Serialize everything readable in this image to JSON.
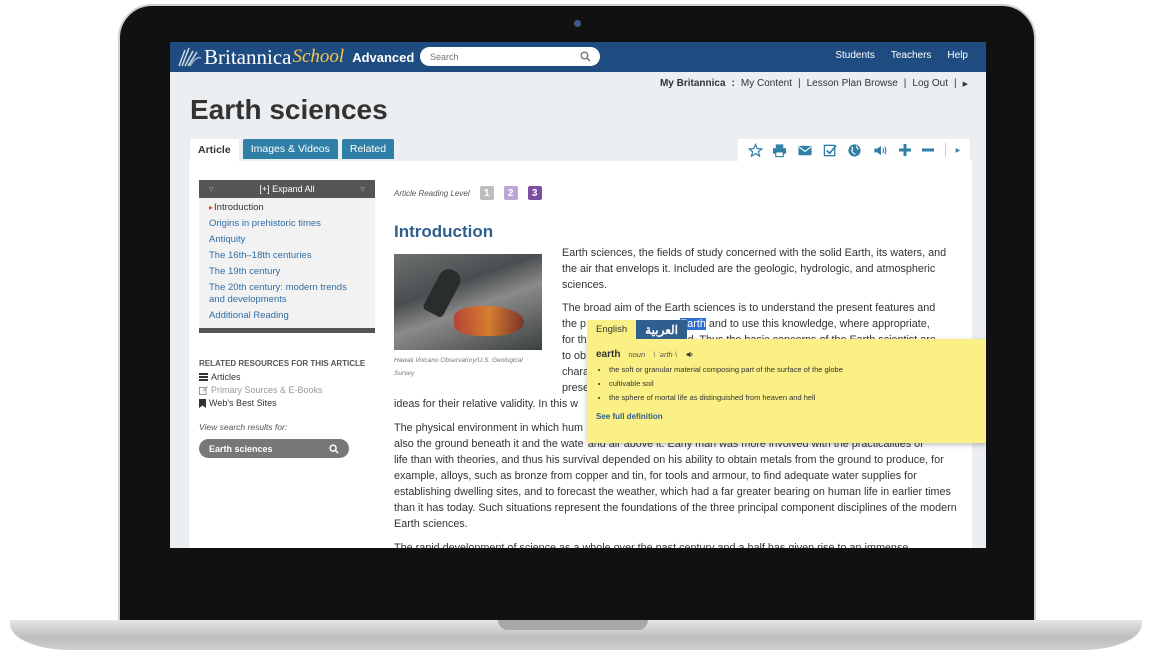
{
  "topbar": {
    "brand": "Britannica",
    "brand_school": "School",
    "edition": "Advanced",
    "search_placeholder": "Search",
    "links": [
      "Students",
      "Teachers",
      "Help"
    ]
  },
  "userbar": {
    "label": "My Britannica",
    "sep": ":",
    "items": [
      "My Content",
      "|",
      "Lesson Plan Browse",
      "|",
      "Log Out",
      "|"
    ]
  },
  "page_title": "Earth sciences",
  "tabs": [
    "Article",
    "Images & Videos",
    "Related"
  ],
  "tools": {
    "icons": [
      "star-icon",
      "print-icon",
      "email-icon",
      "cite-icon",
      "translate-globe-icon",
      "audio-icon",
      "zoom-in-icon",
      "zoom-out-icon"
    ],
    "accent": "#2f7fa6"
  },
  "toc": {
    "expand_label": "[+] Expand All",
    "items": [
      "Introduction",
      "Origins in prehistoric times",
      "Antiquity",
      "The 16th–18th centuries",
      "The 19th century",
      "The 20th century: modern trends and developments",
      "Additional Reading"
    ]
  },
  "related": {
    "title": "RELATED RESOURCES FOR THIS ARTICLE",
    "items": [
      "Articles",
      "Primary Sources & E-Books",
      "Web's Best Sites"
    ],
    "view_label": "View search results for:",
    "search_term": "Earth sciences"
  },
  "article": {
    "reading_level_label": "Article Reading Level",
    "levels": [
      "1",
      "2",
      "3"
    ],
    "heading": "Introduction",
    "caption": "Hawaii Volcano Observatory/U.S. Geological Survey",
    "p1": "Earth sciences, the fields of study concerned with the solid Earth, its waters, and the air that envelops it. Included are the geologic, hydrologic, and atmospheric sciences.",
    "p2_line1": "The broad aim of the Earth sciences is to understand the present features and",
    "p2_line2_a": "the p",
    "p2_line2_hl": "Earth",
    "p2_line2_b": "and to use this knowledge, where appropriate,",
    "p2_line3_a": "for th",
    "p2_line3_b": "nd. Thus the basic concerns of the Earth scientist are",
    "p2_line4": "to ob",
    "p2_line5": "chara",
    "p2_line6": "prese",
    "p2_last": "ideas for their relative validity. In this w",
    "p3_line1": "The physical environment in which hum",
    "p3_line2_a": "also the ground beneath it and the wate",
    "p3_line2_b": "and air above it. Early man was more involved with the practicalities of",
    "p3_rest": "life than with theories, and thus his survival depended on his ability to obtain metals from the ground to produce, for example, alloys, such as bronze from copper and tin, for tools and armour, to find adequate water supplies for establishing dwelling sites, and to forecast the weather, which had a far greater bearing on human life in earlier times than it has today. Such situations represent the foundations of the three principal component disciplines of the modern Earth sciences.",
    "p4": "The rapid development of science as a whole over the past century and a half has given rise to an immense"
  },
  "dictionary": {
    "lang_en": "English",
    "lang_ar": "العربية",
    "word": "earth",
    "pos": "noun",
    "pron": "\\ ˈərth \\",
    "defs": [
      "the soft or granular material composing part of the surface of the globe",
      "cultivable soil",
      "the sphere of mortal life as distinguished from heaven and hell"
    ],
    "see_full": "See full definition"
  }
}
